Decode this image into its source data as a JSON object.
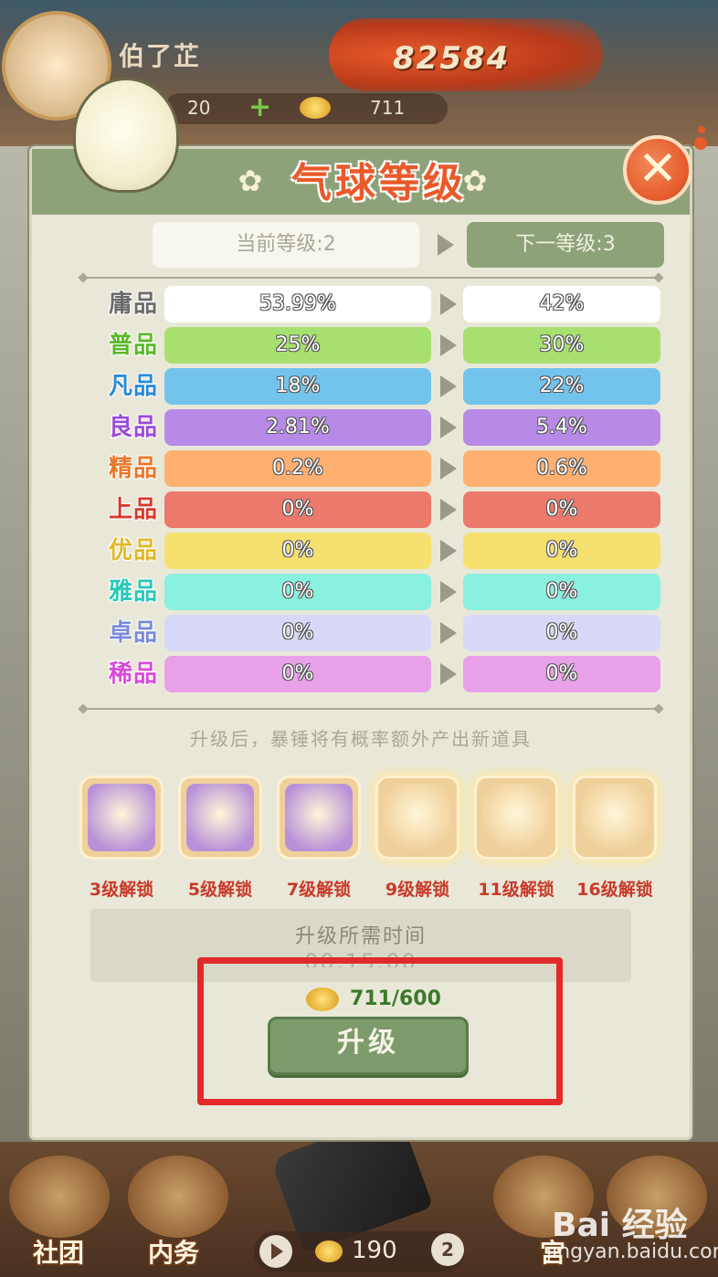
{
  "player": {
    "name": "伯了芷",
    "score": "82584",
    "stat_a": "20",
    "stat_b": "711"
  },
  "dialog": {
    "title": "气球等级",
    "current_level": "当前等级:2",
    "next_level": "下一等级:3",
    "close_glyph": "✕",
    "rows": [
      {
        "label": "庸品",
        "current": "53.99%",
        "next": "42%",
        "color": "#ffffff",
        "label_color": "#6a6a6a"
      },
      {
        "label": "普品",
        "current": "25%",
        "next": "30%",
        "color": "#a8e070",
        "label_color": "#5ab82a"
      },
      {
        "label": "凡品",
        "current": "18%",
        "next": "22%",
        "color": "#72c4ec",
        "label_color": "#2a8ad8"
      },
      {
        "label": "良品",
        "current": "2.81%",
        "next": "5.4%",
        "color": "#b88ae8",
        "label_color": "#9a4ad8"
      },
      {
        "label": "精品",
        "current": "0.2%",
        "next": "0.6%",
        "color": "#ffb070",
        "label_color": "#e8782a"
      },
      {
        "label": "上品",
        "current": "0%",
        "next": "0%",
        "color": "#ec7a6a",
        "label_color": "#d8382a"
      },
      {
        "label": "优品",
        "current": "0%",
        "next": "0%",
        "color": "#f6e070",
        "label_color": "#e0b82a"
      },
      {
        "label": "雅品",
        "current": "0%",
        "next": "0%",
        "color": "#8af0e0",
        "label_color": "#2ac8b8"
      },
      {
        "label": "卓品",
        "current": "0%",
        "next": "0%",
        "color": "#d8d8f8",
        "label_color": "#7a8ad8"
      },
      {
        "label": "稀品",
        "current": "0%",
        "next": "0%",
        "color": "#e8a0e8",
        "label_color": "#d84ad8"
      }
    ],
    "note": "升级后，暴锤将有概率额外产出新道具",
    "unlocks": [
      {
        "label": "3级解锁",
        "icon": "token-icon",
        "bg": "#b890d8"
      },
      {
        "label": "5级解锁",
        "icon": "teapot-icon",
        "bg": "#b890d8"
      },
      {
        "label": "7级解锁",
        "icon": "food-bag-icon",
        "bg": "#b890d8"
      },
      {
        "label": "9级解锁",
        "icon": "crystal-flower-icon",
        "bg": "#f0d09a"
      },
      {
        "label": "11级解锁",
        "icon": "scroll-icon",
        "bg": "#f0d09a"
      },
      {
        "label": "16级解锁",
        "icon": "gold-ingot-icon",
        "bg": "#f0d09a"
      }
    ],
    "time_label": "升级所需时间",
    "time_value": "00:15:00",
    "cost": "711/600",
    "upgrade_button": "升级"
  },
  "nav": {
    "left_label": "社团",
    "mid_label": "内务",
    "right_label": "宫",
    "counter": "190",
    "badge": "2"
  },
  "watermark": {
    "brand": "Bai 经验",
    "url": "jingyan.baidu.com"
  }
}
